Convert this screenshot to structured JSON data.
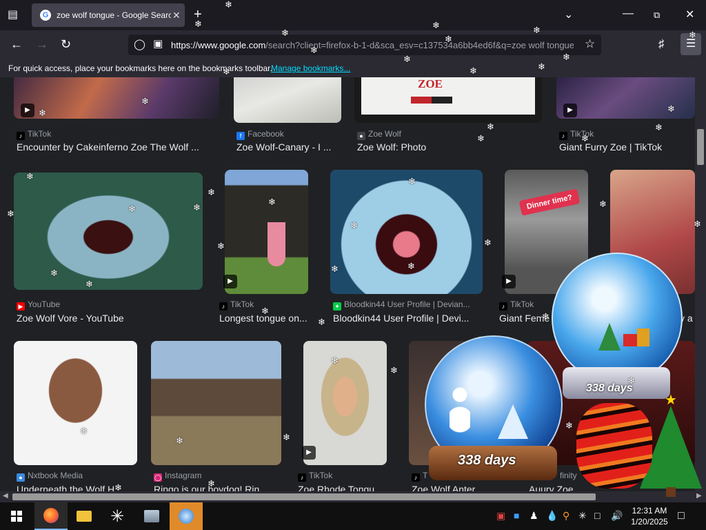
{
  "browser": {
    "tab_title": "zoe wolf tongue - Google Search",
    "new_tab_label": "+",
    "url_host": "https://www.google.com",
    "url_rest": "/search?client=firefox-b-1-d&sca_esv=c137534a6bb4ed6f&q=zoe wolf tongue",
    "bookmarks_text": "For quick access, place your bookmarks here on the bookmarks toolbar.",
    "bookmarks_link": "Manage bookmarks..."
  },
  "results_row1": [
    {
      "source": "TikTok",
      "title": "Encounter by Cakeinferno Zoe The Wolf ..."
    },
    {
      "source": "Facebook",
      "title": "Zoe Wolf-Canary - I ..."
    },
    {
      "source": "Zoe Wolf",
      "title": "Zoe Wolf: Photo",
      "image_text": "ZOE"
    },
    {
      "source": "TikTok",
      "title": "Giant Furry Zoe | TikTok"
    }
  ],
  "results_row2": [
    {
      "source": "YouTube",
      "title": "Zoe Wolf Vore - YouTube"
    },
    {
      "source": "TikTok",
      "title": "Longest tongue on..."
    },
    {
      "source": "Bloodkin44 User Profile | Devian...",
      "title": "Bloodkin44 User Profile | Devi..."
    },
    {
      "source": "TikTok",
      "title": "Giant Feme",
      "image_text": "Dinner time?"
    },
    {
      "source": "",
      "title": "y a"
    }
  ],
  "results_row3": [
    {
      "source": "Nxtbook Media",
      "title": "Underneath the Wolf H"
    },
    {
      "source": "Instagram",
      "title": "Ringo is our boydog! Rin"
    },
    {
      "source": "TikTok",
      "title": "Zoe Rhode Tongu"
    },
    {
      "source": "T",
      "title": "Zoe Wolf Anter"
    },
    {
      "source": "finity",
      "title": "Auury Zoe"
    }
  ],
  "overlay": {
    "globe_small_days": "338 days",
    "globe_large_days": "338 days"
  },
  "taskbar": {
    "time": "12:31 AM",
    "date": "1/20/2025"
  },
  "colors": {
    "link": "#00ddff",
    "tab_active": "#42414d",
    "page_bg": "#202124"
  }
}
